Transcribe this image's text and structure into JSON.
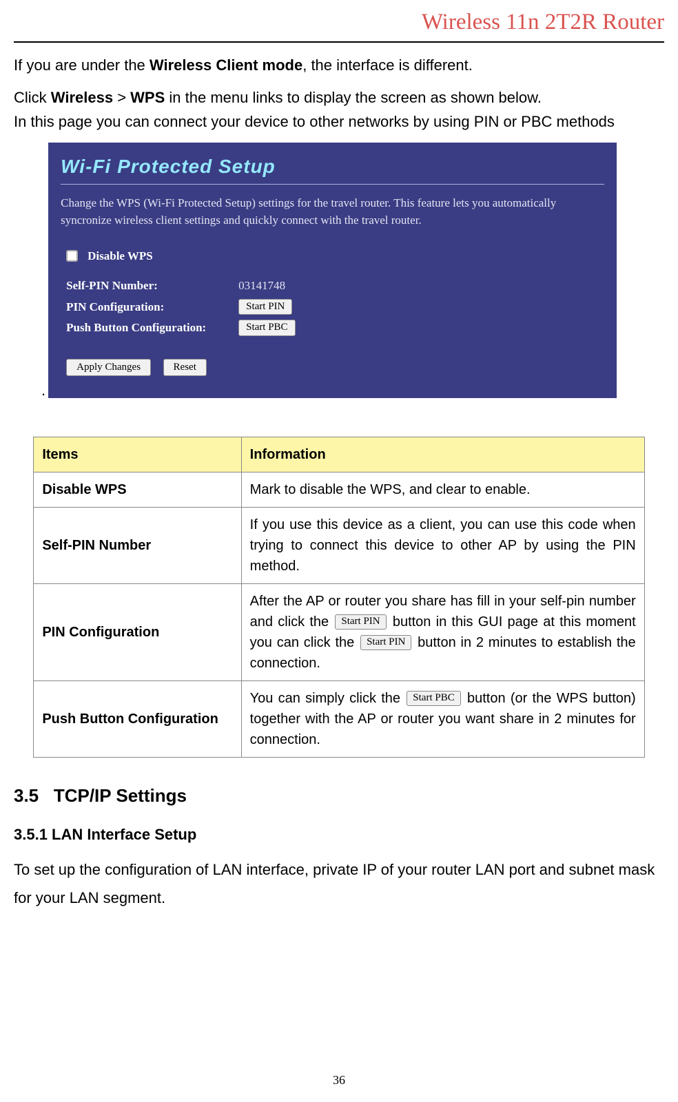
{
  "header": {
    "title": "Wireless 11n 2T2R Router"
  },
  "intro": {
    "p1_a": "If you are under the ",
    "p1_b": "Wireless Client mode",
    "p1_c": ", the interface is different.",
    "p2_a": "Click ",
    "p2_b": "Wireless",
    "p2_c": " > ",
    "p2_d": "WPS",
    "p2_e": " in the menu links to display the screen as shown below.",
    "p3": "In this page you can connect your device to other networks by using PIN or PBC methods"
  },
  "screenshot": {
    "title": "Wi-Fi Protected Setup",
    "desc": "Change the WPS (Wi-Fi Protected Setup) settings for the travel router. This feature lets you automatically syncronize wireless client settings and quickly connect with the travel router.",
    "disable_label": "Disable WPS",
    "self_pin_label": "Self-PIN Number:",
    "self_pin_value": "03141748",
    "pin_conf_label": "PIN Configuration:",
    "start_pin_btn": "Start PIN",
    "pbc_label": "Push Button Configuration:",
    "start_pbc_btn": "Start PBC",
    "apply_btn": "Apply Changes",
    "reset_btn": "Reset"
  },
  "table": {
    "head_items": "Items",
    "head_info": "Information",
    "rows": [
      {
        "item": "Disable WPS",
        "info": "Mark to disable the WPS, and clear to enable."
      },
      {
        "item": "Self-PIN Number",
        "info": "If you use this device as a client, you can use this code when trying to connect this device to other AP by using the PIN method."
      },
      {
        "item": "PIN Configuration",
        "info_a": "After the AP or router you share has fill in your self-pin number and click the ",
        "btn1": "Start PIN",
        "info_b": " button in this GUI page at this moment you can click the ",
        "btn2": "Start PIN",
        "info_c": " button in 2 minutes to establish the connection."
      },
      {
        "item": "Push Button Configuration",
        "info_a": "You can simply click the ",
        "btn1": "Start PBC",
        "info_b": " button (or the WPS button) together with the AP or router you want share in 2 minutes for connection."
      }
    ]
  },
  "sections": {
    "s35_num": "3.5",
    "s35_title": "TCP/IP Settings",
    "s351": "3.5.1 LAN Interface Setup",
    "s351_body": "To set up the configuration of LAN interface, private IP of your router LAN port and subnet mask for your LAN segment."
  },
  "page_number": "36"
}
